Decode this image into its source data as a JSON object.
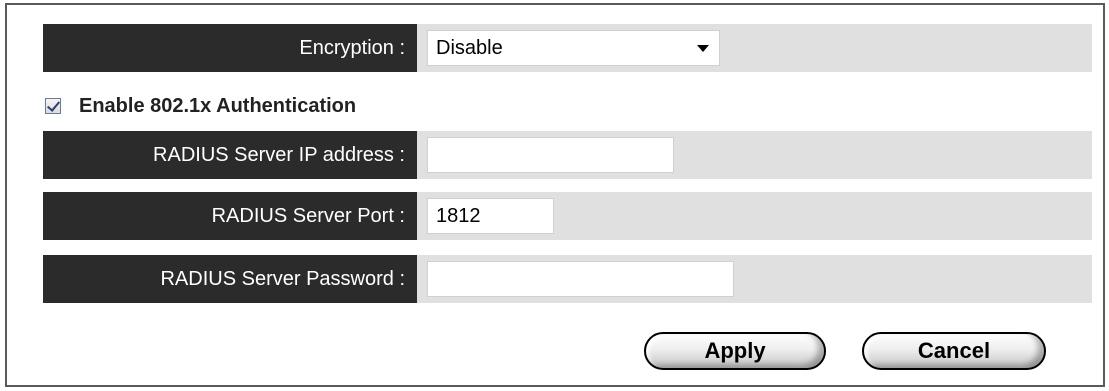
{
  "encryption": {
    "label": "Encryption :",
    "selected": "Disable"
  },
  "auth": {
    "label": "Enable 802.1x Authentication",
    "checked": true
  },
  "radius_ip": {
    "label": "RADIUS Server IP address :",
    "value": ""
  },
  "radius_port": {
    "label": "RADIUS Server Port :",
    "value": "1812"
  },
  "radius_password": {
    "label": "RADIUS Server Password :",
    "value": ""
  },
  "buttons": {
    "apply": "Apply",
    "cancel": "Cancel"
  },
  "colors": {
    "label_bg": "#2b2b2b",
    "value_bg": "#e0e0e0",
    "border": "#5a5a5a"
  },
  "icons": {
    "dropdown": "chevron-down-icon",
    "checkbox": "checkmark-icon"
  }
}
